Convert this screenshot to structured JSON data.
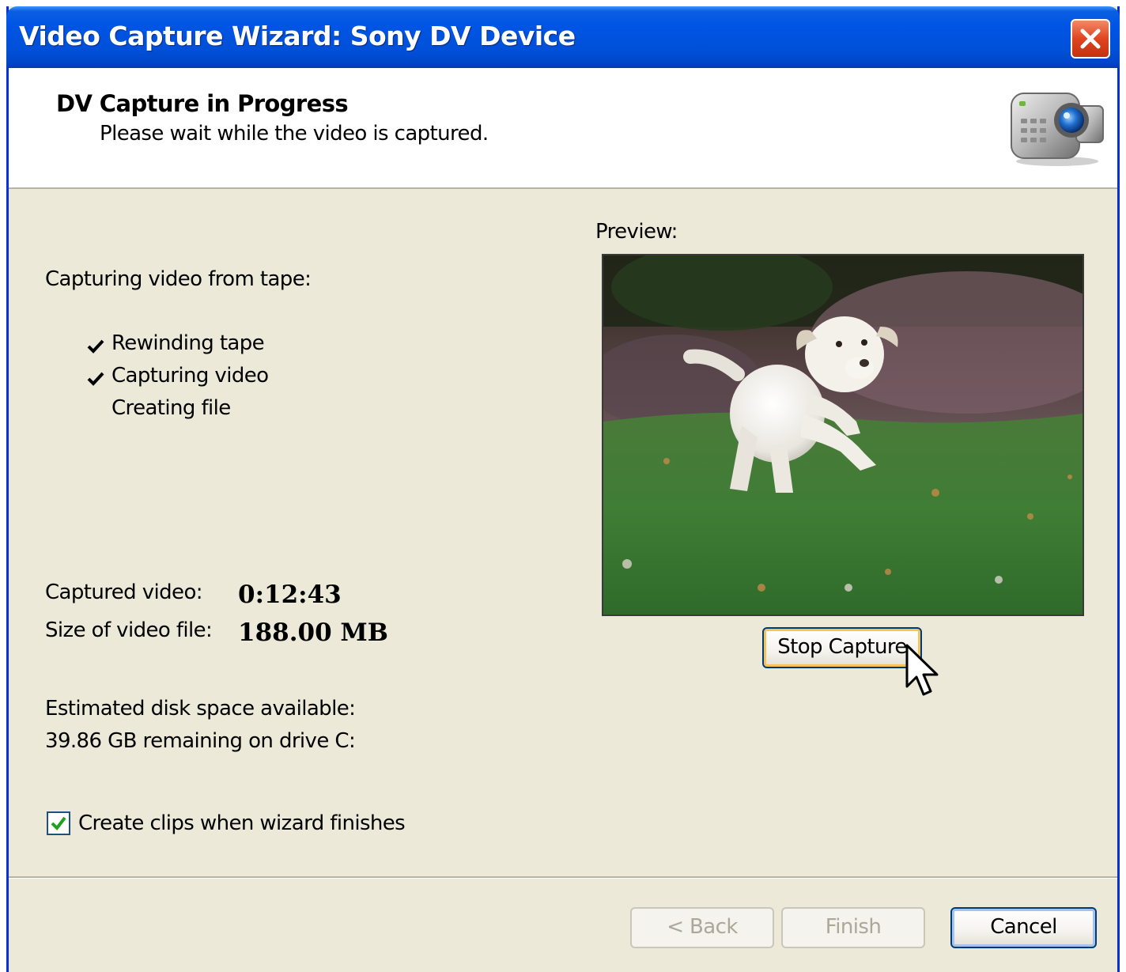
{
  "window": {
    "title": "Video Capture Wizard: Sony DV Device"
  },
  "header": {
    "title": "DV Capture in Progress",
    "subtitle": "Please wait while the video is captured.",
    "icon": "camcorder-icon"
  },
  "status": {
    "heading": "Capturing video from tape:",
    "steps": [
      {
        "label": "Rewinding tape",
        "done": true
      },
      {
        "label": "Capturing video",
        "done": true
      },
      {
        "label": "Creating file",
        "done": false
      }
    ]
  },
  "stats": {
    "captured_label": "Captured video:",
    "captured_value": "0:12:43",
    "size_label": "Size of video file:",
    "size_value": "188.00 MB",
    "disk_label": "Estimated disk space available:",
    "disk_value": "39.86 GB remaining on drive C:"
  },
  "preview": {
    "label": "Preview:",
    "stop_button": "Stop Capture"
  },
  "options": {
    "create_clips_label": "Create clips when wizard finishes",
    "create_clips_checked": true
  },
  "footer": {
    "back_label": "< Back",
    "finish_label": "Finish",
    "cancel_label": "Cancel"
  },
  "colors": {
    "titlebar": "#0055e5",
    "dialog_bg": "#ece9d8",
    "focus_ring": "#f5c25b"
  }
}
